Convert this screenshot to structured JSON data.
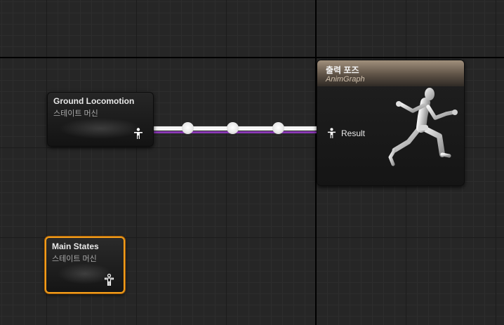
{
  "graph": {
    "nodes": {
      "ground_locomotion": {
        "title": "Ground Locomotion",
        "subtitle": "스테이트 머신",
        "icon": "pose-pin-icon"
      },
      "main_states": {
        "title": "Main States",
        "subtitle": "스테이트 머신",
        "icon": "pose-pin-icon",
        "selected": true
      },
      "output_pose": {
        "title": "출력 포즈",
        "subtitle": "AnimGraph",
        "pin_label": "Result",
        "preview": "mannequin-run-icon"
      }
    },
    "connection": {
      "from": "Ground Locomotion",
      "to": "Result",
      "reroute_knots": 3
    },
    "colors": {
      "background": "#262626",
      "wire": "#f4f4f4",
      "wire_accent": "#8a38b4",
      "selection": "#f19c1a",
      "output_header": "#a1907c"
    }
  }
}
